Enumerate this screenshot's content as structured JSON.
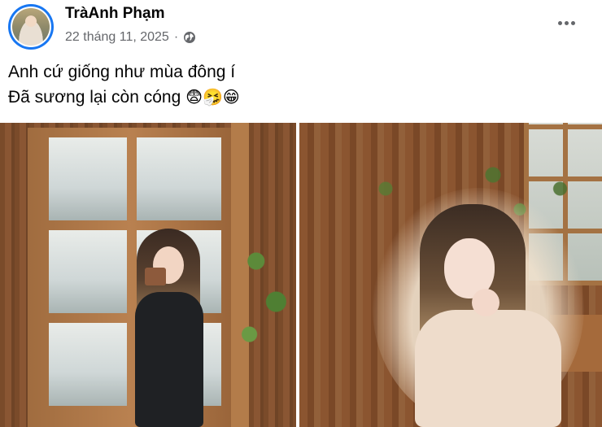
{
  "post": {
    "author": "TràAnh Phạm",
    "date": "22 tháng 11, 2025",
    "separator": "·",
    "privacy_icon": "globe-icon",
    "more_icon": "more-options-icon",
    "caption_line_1": "Anh cứ giống như mùa đông í",
    "caption_line_2": "Đã sương lại còn cóng",
    "caption_emojis": [
      "😨",
      "🤧",
      "😁"
    ]
  },
  "photos": [
    "photo-1",
    "photo-2"
  ],
  "colors": {
    "accent": "#1877f2",
    "secondary_text": "#65676b"
  }
}
